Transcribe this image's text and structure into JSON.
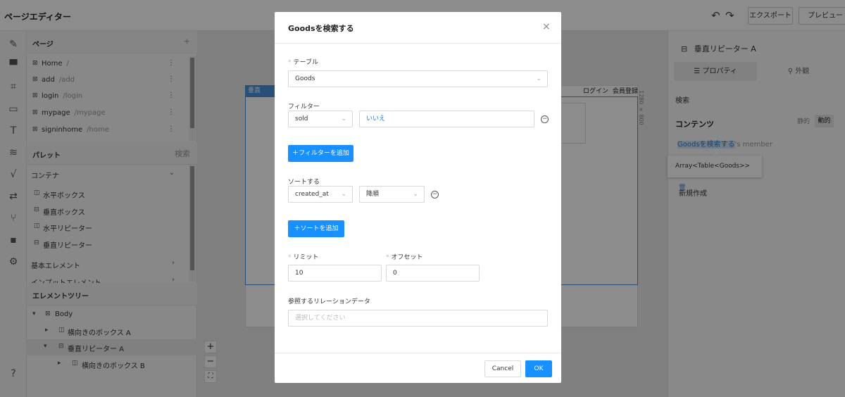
{
  "app": {
    "title": "ページエディター",
    "undo_icon": "undo-icon",
    "redo_icon": "redo-icon",
    "export_label": "エクスポート",
    "preview_label": "プレビュー"
  },
  "rail": {
    "icons": [
      "brush-tools-icon",
      "paint-roller-icon",
      "crop-icon",
      "monitor-icon",
      "text-size-icon",
      "database-icon",
      "function-icon",
      "workflow-icon",
      "branch-icon",
      "ab-test-icon",
      "gear-icon",
      "help-icon"
    ]
  },
  "pages": {
    "header": "ページ",
    "add_symbol": "+",
    "items": [
      {
        "name": "Home",
        "path": "/"
      },
      {
        "name": "add",
        "path": "/add"
      },
      {
        "name": "login",
        "path": "/login"
      },
      {
        "name": "mypage",
        "path": "/mypage"
      },
      {
        "name": "signinhome",
        "path": "/home"
      }
    ]
  },
  "palette": {
    "header": "パレット",
    "search_label": "検索",
    "category": "コンテナ",
    "items": [
      "水平ボックス",
      "垂直ボックス",
      "水平リピーター",
      "垂直リピーター"
    ],
    "more_categories": [
      "基本エレメント",
      "インプットエレメント"
    ]
  },
  "tree": {
    "header": "エレメントツリー",
    "items": [
      "Body",
      "横向きのボックス A",
      "垂直リピーター A",
      "横向きのボックス B"
    ]
  },
  "canvas": {
    "tag_label": "垂直",
    "nav_login": "ログイン",
    "nav_signup": "会員登録",
    "size_label": "1280 × 800",
    "zoom_in": "+",
    "zoom_out": "−",
    "fit": "⛶"
  },
  "right": {
    "title": "垂直リピーター A",
    "tab_properties": "プロパティ",
    "tab_appearance": "外観",
    "search": "検索",
    "contents": "コンテンツ",
    "seg_static": "静的",
    "seg_dynamic": "動的",
    "member_highlight": "Goodsを検索する",
    "member_suffix": "'s member",
    "tooltip_text": "Array<Table<Goods>>",
    "new_label": "新規作成"
  },
  "modal": {
    "title": "Goodsを検索する",
    "close": "×",
    "table_label": "テーブル",
    "table_value": "Goods",
    "filter_label": "フィルター",
    "filter_field": "sold",
    "filter_value": "いいえ",
    "add_filter": "＋フィルターを追加",
    "sort_label": "ソートする",
    "sort_field": "created_at",
    "sort_order": "降順",
    "add_sort": "＋ソートを追加",
    "limit_label": "リミット",
    "limit_value": "10",
    "offset_label": "オフセット",
    "offset_value": "0",
    "relation_label": "参照するリレーションデータ",
    "relation_placeholder": "選択してください",
    "cancel": "Cancel",
    "ok": "OK"
  }
}
